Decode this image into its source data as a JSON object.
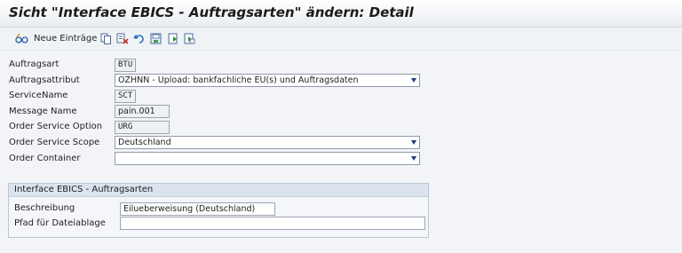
{
  "window": {
    "title": "Sicht \"Interface EBICS - Auftragsarten\" ändern: Detail"
  },
  "toolbar": {
    "new_entries_label": "Neue Einträge",
    "icons": [
      "glasses-icon",
      "copy-icon",
      "delete-icon",
      "undo-icon",
      "save-icon",
      "previous-entry-icon",
      "next-entry-icon"
    ]
  },
  "form": {
    "auftragsart": {
      "label": "Auftragsart",
      "value": "BTU"
    },
    "auftragsattribut": {
      "label": "Auftragsattribut",
      "value": "OZHNN - Upload: bankfachliche EU(s) und Auftragsdaten"
    },
    "servicename": {
      "label": "ServiceName",
      "value": "SCT"
    },
    "message_name": {
      "label": "Message Name",
      "value": "pain.001"
    },
    "order_service_option": {
      "label": "Order Service Option",
      "value": "URG"
    },
    "order_service_scope": {
      "label": "Order Service Scope",
      "value": "Deutschland"
    },
    "order_container": {
      "label": "Order Container",
      "value": ""
    }
  },
  "group": {
    "title": "Interface EBICS - Auftragsarten",
    "beschreibung": {
      "label": "Beschreibung",
      "value": "Eilueberweisung (Deutschland)"
    },
    "pfad": {
      "label": "Pfad für Dateiablage",
      "value": ""
    }
  },
  "colors": {
    "background": "#f2f4f7",
    "field_border": "#9aa5b1",
    "group_header": "#dbe3ee",
    "dropdown_arrow": "#1e3f73"
  }
}
